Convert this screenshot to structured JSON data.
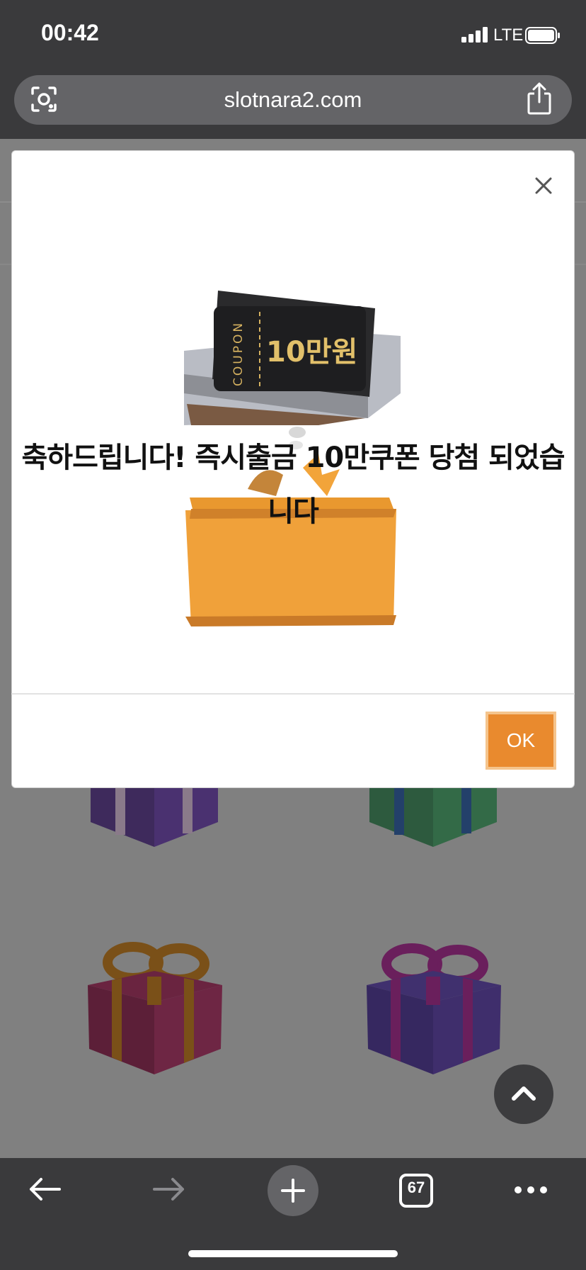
{
  "status_bar": {
    "time": "00:42",
    "network": "LTE",
    "icons": [
      "signal-icon",
      "battery-icon"
    ]
  },
  "browser": {
    "url": "slotnara2.com",
    "icons": [
      "lens-icon",
      "share-icon"
    ]
  },
  "modal": {
    "message": "축하드립니다! 즉시출금 10만쿠폰 당첨 되었습니다",
    "coupon_label": "COUPON",
    "coupon_value": "10만원",
    "ok_label": "OK",
    "close_icon": "close-icon",
    "accent_color": "#e98a2e"
  },
  "background_page": {
    "gifts": [
      "purple-gift",
      "green-gift",
      "red-gift",
      "purple-gift"
    ]
  },
  "toolbar": {
    "tab_count": "67",
    "icons": [
      "back-arrow-icon",
      "forward-arrow-icon",
      "plus-icon",
      "tabs-icon",
      "more-icon"
    ]
  }
}
